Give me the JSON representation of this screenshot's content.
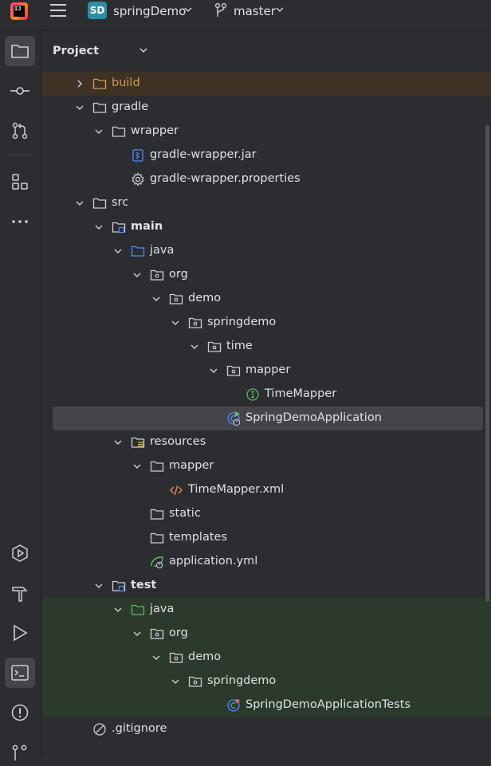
{
  "topbar": {
    "logo_text": "IJ",
    "project_badge": "SD",
    "project_name": "springDemo",
    "branch_name": "master"
  },
  "panel": {
    "title": "Project"
  },
  "tree": [
    {
      "label": "build",
      "depth": 1,
      "expanded": false,
      "icon": "folder-icon",
      "style": "excluded"
    },
    {
      "label": "gradle",
      "depth": 1,
      "expanded": true,
      "icon": "folder-icon"
    },
    {
      "label": "wrapper",
      "depth": 2,
      "expanded": true,
      "icon": "folder-icon"
    },
    {
      "label": "gradle-wrapper.jar",
      "depth": 3,
      "icon": "jar-file-icon"
    },
    {
      "label": "gradle-wrapper.properties",
      "depth": 3,
      "icon": "gear-icon"
    },
    {
      "label": "src",
      "depth": 1,
      "expanded": true,
      "icon": "folder-icon"
    },
    {
      "label": "main",
      "depth": 2,
      "expanded": true,
      "icon": "module-folder-icon",
      "bold": true
    },
    {
      "label": "java",
      "depth": 3,
      "expanded": true,
      "icon": "source-folder-icon"
    },
    {
      "label": "org",
      "depth": 4,
      "expanded": true,
      "icon": "package-icon"
    },
    {
      "label": "demo",
      "depth": 5,
      "expanded": true,
      "icon": "package-icon"
    },
    {
      "label": "springdemo",
      "depth": 6,
      "expanded": true,
      "icon": "package-icon"
    },
    {
      "label": "time",
      "depth": 7,
      "expanded": true,
      "icon": "package-icon"
    },
    {
      "label": "mapper",
      "depth": 8,
      "expanded": true,
      "icon": "package-icon"
    },
    {
      "label": "TimeMapper",
      "depth": 9,
      "icon": "interface-icon"
    },
    {
      "label": "SpringDemoApplication",
      "depth": 8,
      "icon": "spring-boot-class-icon",
      "style": "selected"
    },
    {
      "label": "resources",
      "depth": 3,
      "expanded": true,
      "icon": "resources-folder-icon"
    },
    {
      "label": "mapper",
      "depth": 4,
      "expanded": true,
      "icon": "folder-icon"
    },
    {
      "label": "TimeMapper.xml",
      "depth": 5,
      "icon": "xml-file-icon"
    },
    {
      "label": "static",
      "depth": 4,
      "icon": "folder-icon"
    },
    {
      "label": "templates",
      "depth": 4,
      "icon": "folder-icon"
    },
    {
      "label": "application.yml",
      "depth": 4,
      "icon": "spring-config-icon"
    },
    {
      "label": "test",
      "depth": 2,
      "expanded": true,
      "icon": "module-folder-icon",
      "bold": true
    },
    {
      "label": "java",
      "depth": 3,
      "expanded": true,
      "icon": "test-source-folder-icon",
      "style": "test"
    },
    {
      "label": "org",
      "depth": 4,
      "expanded": true,
      "icon": "package-icon",
      "style": "test"
    },
    {
      "label": "demo",
      "depth": 5,
      "expanded": true,
      "icon": "package-icon",
      "style": "test"
    },
    {
      "label": "springdemo",
      "depth": 6,
      "expanded": true,
      "icon": "package-icon",
      "style": "test"
    },
    {
      "label": "SpringDemoApplicationTests",
      "depth": 8,
      "icon": "spring-test-class-icon",
      "style": "test"
    },
    {
      "label": ".gitignore",
      "depth": 1,
      "icon": "ignored-file-icon"
    }
  ],
  "sidebar": {
    "top_icons": [
      "folder-icon",
      "commit-icon",
      "pull-request-icon",
      "structure-icon",
      "more-icon"
    ],
    "bottom_icons": [
      "services-icon",
      "build-icon",
      "run-icon",
      "terminal-icon",
      "problems-icon",
      "git-icon"
    ]
  },
  "colors": {
    "background": "#2b2d30",
    "excluded_row": "#3d3223",
    "test_row": "#2b3a2b",
    "selected_row": "#43454a",
    "source_folder": "#548af7",
    "test_folder": "#5fb865"
  }
}
